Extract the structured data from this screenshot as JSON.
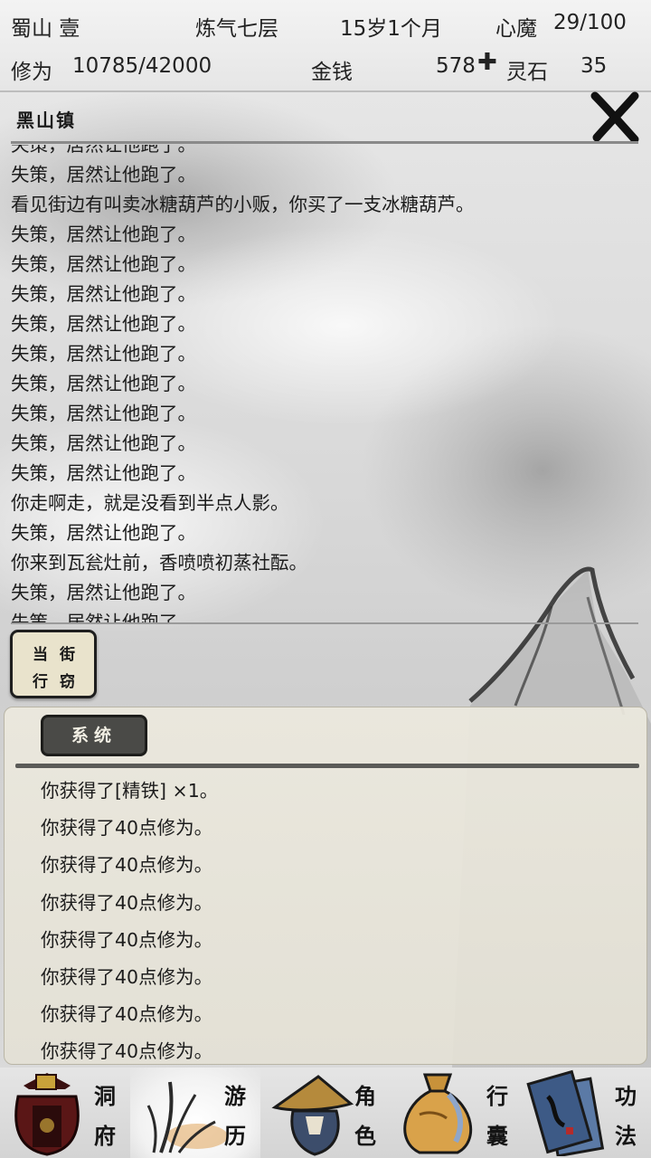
{
  "header": {
    "sect_label": "蜀山 壹",
    "realm": "炼气七层",
    "age": "15岁1个月",
    "heart_demon_label": "心魔",
    "heart_demon_value": "29/100",
    "cultivation_label": "修为",
    "cultivation_value": "10785/42000",
    "money_label": "金钱",
    "money_value": "578",
    "spirit_stone_label": "灵石",
    "spirit_stone_value": "35"
  },
  "location": {
    "name": "黑山镇",
    "close_icon": "close-x-icon"
  },
  "log": {
    "lines": [
      "失策，居然让他跑了。",
      "失策，居然让他跑了。",
      "看见街边有叫卖冰糖葫芦的小贩，你买了一支冰糖葫芦。",
      "失策，居然让他跑了。",
      "失策，居然让他跑了。",
      "失策，居然让他跑了。",
      "失策，居然让他跑了。",
      "失策，居然让他跑了。",
      "失策，居然让他跑了。",
      "失策，居然让他跑了。",
      "失策，居然让他跑了。",
      "失策，居然让他跑了。",
      "你走啊走，就是没看到半点人影。",
      "失策，居然让他跑了。",
      "你来到瓦瓮灶前，香喷喷初蒸社酝。",
      "失策，居然让他跑了。",
      "失策，居然让他跑了。"
    ]
  },
  "action": {
    "chars": [
      "当",
      "街",
      "行",
      "窃"
    ]
  },
  "system": {
    "tab_label": "系统",
    "lines": [
      "你获得了[精铁] ×1。",
      "你获得了40点修为。",
      "你获得了40点修为。",
      "你获得了40点修为。",
      "你获得了40点修为。",
      "你获得了40点修为。",
      "你获得了40点修为。",
      "你获得了40点修为。"
    ]
  },
  "nav": {
    "items": [
      {
        "c1": "洞",
        "c2": "府",
        "icon": "cave-dwelling-icon"
      },
      {
        "c1": "游",
        "c2": "历",
        "icon": "travel-reeds-icon"
      },
      {
        "c1": "角",
        "c2": "色",
        "icon": "straw-hat-character-icon"
      },
      {
        "c1": "行",
        "c2": "囊",
        "icon": "bag-icon"
      },
      {
        "c1": "功",
        "c2": "法",
        "icon": "scroll-books-icon"
      }
    ]
  },
  "colors": {
    "active_nav": "#f4f4f4",
    "panel_tab": "#4a4a47",
    "ink": "#1a1a1a"
  }
}
